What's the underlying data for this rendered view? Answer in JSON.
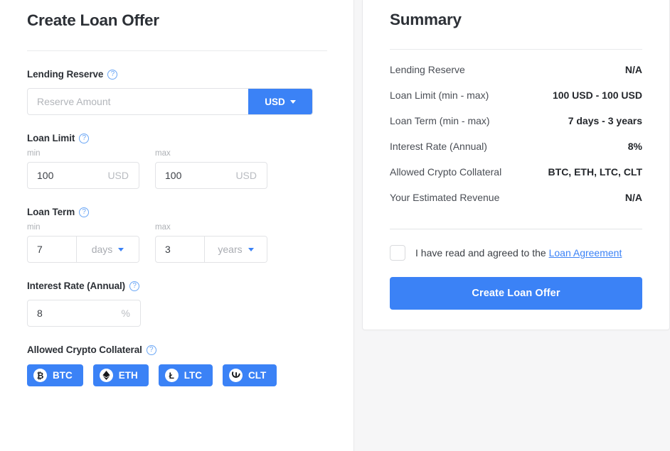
{
  "form": {
    "title": "Create Loan Offer",
    "help_glyph": "?",
    "lending_reserve": {
      "label": "Lending Reserve",
      "placeholder": "Reserve Amount",
      "value": "",
      "currency": "USD"
    },
    "loan_limit": {
      "label": "Loan Limit",
      "min_label": "min",
      "max_label": "max",
      "min_value": "100",
      "max_value": "100",
      "min_unit": "USD",
      "max_unit": "USD"
    },
    "loan_term": {
      "label": "Loan Term",
      "min_label": "min",
      "max_label": "max",
      "min_value": "7",
      "max_value": "3",
      "min_unit": "days",
      "max_unit": "years"
    },
    "interest_rate": {
      "label": "Interest Rate (Annual)",
      "value": "8",
      "unit": "%"
    },
    "collateral": {
      "label": "Allowed Crypto Collateral",
      "chips": [
        {
          "ticker": "BTC",
          "icon": "bitcoin-icon"
        },
        {
          "ticker": "ETH",
          "icon": "ethereum-icon"
        },
        {
          "ticker": "LTC",
          "icon": "litecoin-icon"
        },
        {
          "ticker": "CLT",
          "icon": "celsius-icon"
        }
      ]
    }
  },
  "summary": {
    "title": "Summary",
    "rows": [
      {
        "key": "Lending Reserve",
        "value": "N/A"
      },
      {
        "key": "Loan Limit (min - max)",
        "value": "100 USD - 100 USD"
      },
      {
        "key": "Loan Term (min - max)",
        "value": "7 days - 3 years"
      },
      {
        "key": "Interest Rate (Annual)",
        "value": "8%"
      },
      {
        "key": "Allowed Crypto Collateral",
        "value": "BTC, ETH, LTC, CLT"
      },
      {
        "key": "Your Estimated Revenue",
        "value": "N/A"
      }
    ],
    "agreement": {
      "checked": false,
      "text": "I have read and agreed to the",
      "link_text": "Loan Agreement"
    },
    "submit_label": "Create Loan Offer"
  },
  "colors": {
    "accent": "#3b82f6",
    "text": "#2c3036",
    "muted": "#aeb1b6",
    "border": "#e2e3e6",
    "page_bg": "#f6f6f7"
  }
}
